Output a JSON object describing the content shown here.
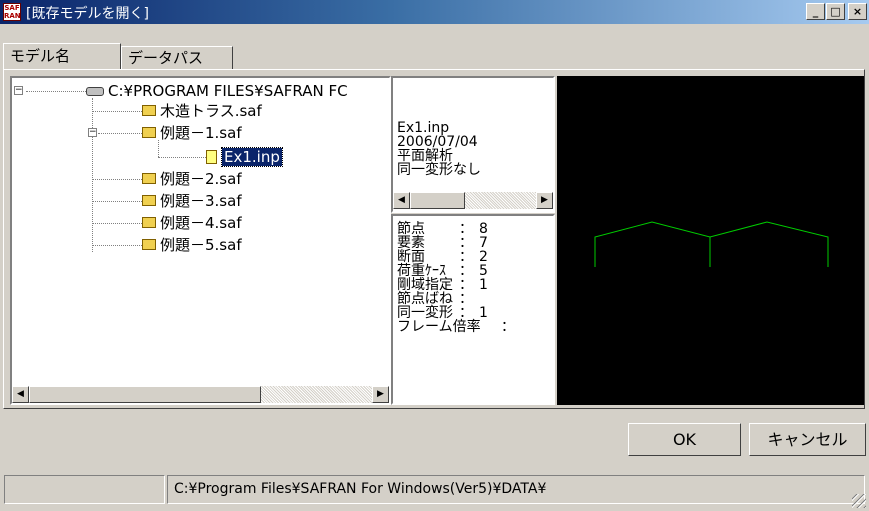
{
  "window": {
    "title": "[既存モデルを開く]",
    "app_icon_text": "SAF RAN",
    "controls": {
      "minimize": "_",
      "maximize": "□",
      "close": "×"
    }
  },
  "tabs": [
    {
      "label": "モデル名",
      "active": true
    },
    {
      "label": "データパス",
      "active": false
    }
  ],
  "tree": {
    "root": "C:¥PROGRAM FILES¥SAFRAN FC",
    "items": [
      {
        "label": "木造トラス.saf",
        "type": "folder"
      },
      {
        "label": "例題－1.saf",
        "type": "folder",
        "expanded": true
      },
      {
        "label": "Ex1.inp",
        "type": "file",
        "selected": true
      },
      {
        "label": "例題－2.saf",
        "type": "folder"
      },
      {
        "label": "例題－3.saf",
        "type": "folder"
      },
      {
        "label": "例題－4.saf",
        "type": "folder"
      },
      {
        "label": "例題－5.saf",
        "type": "folder"
      }
    ]
  },
  "file_info": {
    "lines": [
      "Ex1.inp",
      "2006/07/04",
      "平面解析",
      "同一変形なし"
    ]
  },
  "stats": {
    "rows": [
      {
        "label": "節点",
        "value": "8"
      },
      {
        "label": "要素",
        "value": "7"
      },
      {
        "label": "断面",
        "value": "2"
      },
      {
        "label": "荷重ｹｰｽ",
        "value": "5"
      },
      {
        "label": "剛域指定",
        "value": "1"
      },
      {
        "label": "節点ばね",
        "value": ""
      },
      {
        "label": "同一変形",
        "value": "1"
      },
      {
        "label": "フレーム倍率",
        "value": ""
      }
    ]
  },
  "preview": {
    "background": "#000000",
    "line_color": "#00cc00"
  },
  "buttons": {
    "ok": "OK",
    "cancel": "キャンセル"
  },
  "status": {
    "path": "C:¥Program Files¥SAFRAN For Windows(Ver5)¥DATA¥"
  }
}
